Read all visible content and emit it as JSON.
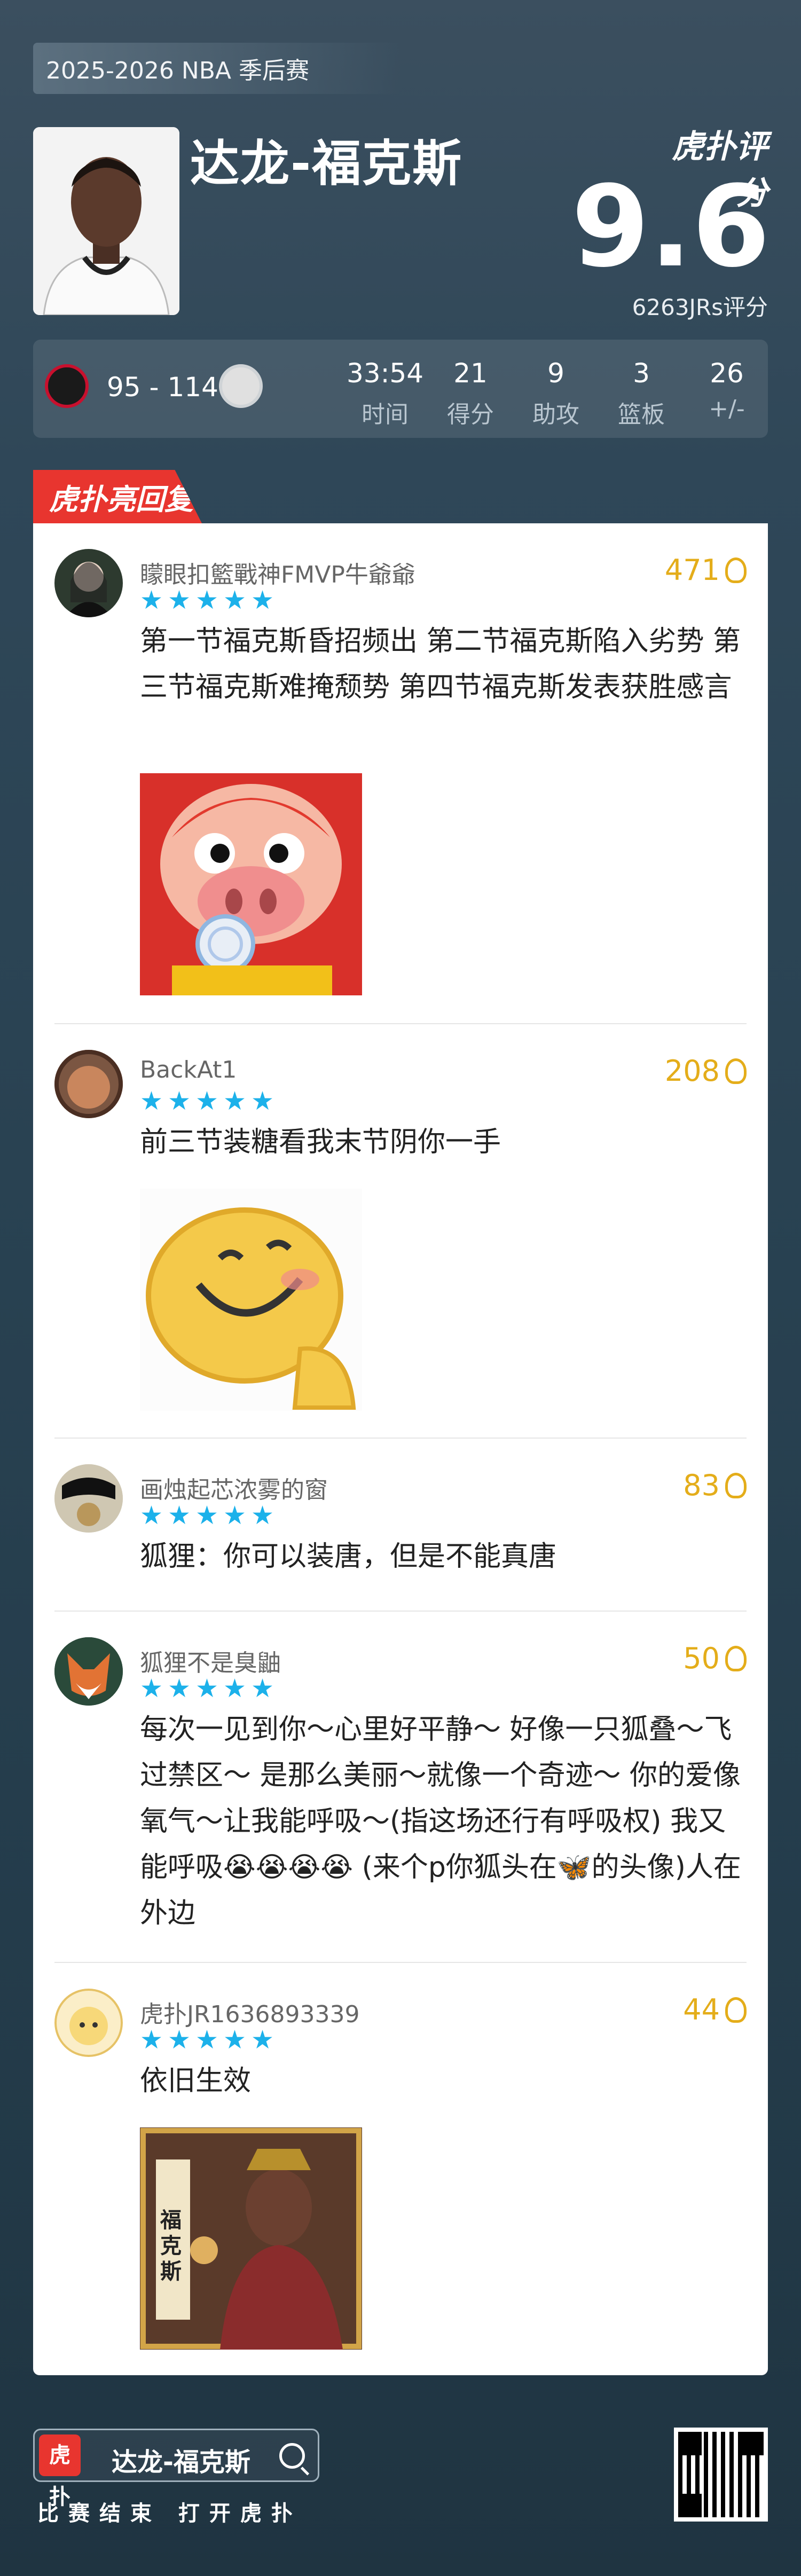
{
  "header": {
    "league_tag": "2025-2026 NBA 季后赛",
    "player_name": "达龙-福克斯",
    "brand": "虎扑评分",
    "score": "9.6",
    "jrs_count": "6263JRs评分"
  },
  "game": {
    "score": "95 - 114",
    "stats": [
      {
        "value": "33:54",
        "label": "时间"
      },
      {
        "value": "21",
        "label": "得分"
      },
      {
        "value": "9",
        "label": "助攻"
      },
      {
        "value": "3",
        "label": "篮板"
      },
      {
        "value": "26",
        "label": "+/-"
      }
    ]
  },
  "section": {
    "badge": "虎扑亮回复"
  },
  "comments": [
    {
      "user": "矇眼扣籃戰神FMVP牛爺爺",
      "likes": "471",
      "rating": 5,
      "text": "第一节福克斯昏招频出 第二节福克斯陷入劣势 第三节福克斯难掩颓势 第四节福克斯发表获胜感言",
      "sticker": "gg-bond-pig-sticker"
    },
    {
      "user": "BackAt1",
      "likes": "208",
      "rating": 5,
      "text": "前三节装糖看我末节阴你一手",
      "sticker": "smiley-sticker"
    },
    {
      "user": "画烛起芯浓雾的窗",
      "likes": "83",
      "rating": 5,
      "text": "狐狸：你可以装唐，但是不能真唐"
    },
    {
      "user": "狐狸不是臭鼬",
      "likes": "50",
      "rating": 5,
      "text": "每次一见到你～心里好平静～ 好像一只狐叠～飞过禁区～ 是那么美丽～就像一个奇迹～ 你的爱像氧气～让我能呼吸～(指这场还行有呼吸权) 我又能呼吸😭😭😭😭 (来个p你狐头在🦋的头像)人在外边"
    },
    {
      "user": "虎扑JR1636893339",
      "likes": "44",
      "rating": 5,
      "text": "依旧生效",
      "sticker": "fox-card-sticker",
      "sticker_text": "福克斯"
    }
  ],
  "footer": {
    "logo_text": "虎扑",
    "search_name": "达龙-福克斯",
    "caption": "比赛结束 打开虎扑"
  },
  "colors": {
    "accent_red": "#e8352f",
    "star_blue": "#1cb1ea",
    "like_gold": "#e4ad1a"
  }
}
